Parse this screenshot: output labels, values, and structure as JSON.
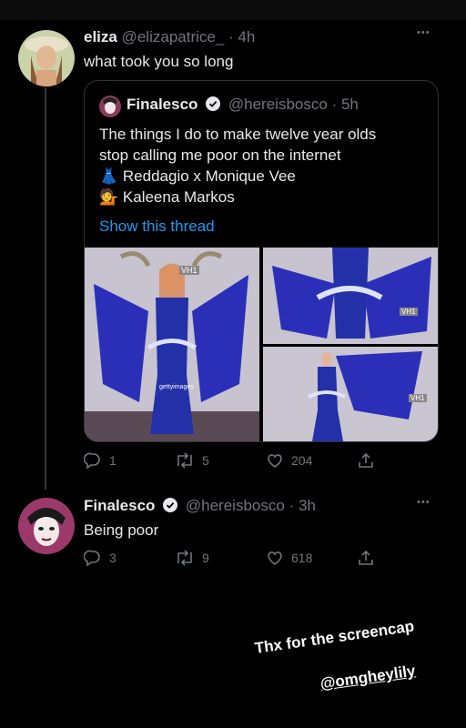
{
  "tweet1": {
    "name": "eliza",
    "handle": "@elizapatrice_",
    "time": "· 4h",
    "text": "what took you so long",
    "more": "•••"
  },
  "quote": {
    "name": "Finalesco",
    "handle": "@hereisbosco",
    "time": "· 5h",
    "line1": "The things I do to make twelve year olds",
    "line2": "stop calling me poor on the internet",
    "line3_emoji": "👗",
    "line3": "Reddagio x Monique Vee",
    "line4_emoji": "💁",
    "line4": "Kaleena Markos",
    "show_thread": "Show this thread",
    "media_labels": [
      "VH1",
      "gettyimages",
      "VH1",
      "VH1"
    ]
  },
  "tweet1_actions": {
    "replies": "1",
    "retweets": "5",
    "likes": "204"
  },
  "tweet2": {
    "name": "Finalesco",
    "handle": "@hereisbosco",
    "time": "· 3h",
    "text": "Being poor",
    "more": "•••"
  },
  "tweet2_actions": {
    "replies": "3",
    "retweets": "9",
    "likes": "618"
  },
  "story": {
    "caption": "Thx for the screencap",
    "mention": "@omgheylily"
  },
  "colors": {
    "accent": "#1d9bf0",
    "muted": "#71767b",
    "background": "#000000"
  }
}
